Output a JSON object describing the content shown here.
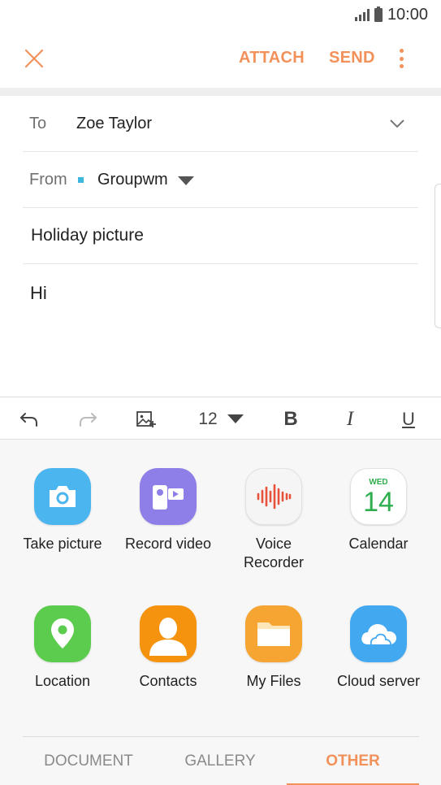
{
  "status_bar": {
    "time": "10:00",
    "signal_icon": "signal-icon",
    "battery_icon": "battery-icon"
  },
  "action_bar": {
    "close_icon": "close-icon",
    "attach_label": "ATTACH",
    "send_label": "SEND",
    "more_icon": "more-vertical-icon",
    "accent_color": "#f2915a"
  },
  "compose": {
    "to_label": "To",
    "to_value": "Zoe Taylor",
    "from_label": "From",
    "from_value": "Groupwm",
    "from_account_color": "#3eb7dc",
    "subject": "Holiday picture",
    "body": "Hi"
  },
  "toolbar": {
    "undo_icon": "undo-icon",
    "redo_icon": "redo-icon",
    "insert_image_icon": "insert-image-icon",
    "font_size": "12",
    "bold_label": "B",
    "italic_label": "I",
    "underline_label": "U"
  },
  "attach_panel": {
    "apps": [
      {
        "label": "Take picture",
        "icon": "camera-icon",
        "color": "#4bb5f0"
      },
      {
        "label": "Record video",
        "icon": "video-recorder-icon",
        "color": "#8d7ee8"
      },
      {
        "label": "Voice Recorder",
        "icon": "voice-recorder-icon",
        "color": "#f5f5f5"
      },
      {
        "label": "Calendar",
        "icon": "calendar-icon",
        "color": "#ffffff",
        "day": "WED",
        "date": "14"
      },
      {
        "label": "Location",
        "icon": "location-icon",
        "color": "#5ccc4e"
      },
      {
        "label": "Contacts",
        "icon": "contacts-icon",
        "color": "#f5930e"
      },
      {
        "label": "My Files",
        "icon": "folder-icon",
        "color": "#f7a532"
      },
      {
        "label": "Cloud server",
        "icon": "cloud-icon",
        "color": "#42a8ef"
      }
    ]
  },
  "tabs": [
    {
      "label": "DOCUMENT",
      "active": false
    },
    {
      "label": "GALLERY",
      "active": false
    },
    {
      "label": "OTHER",
      "active": true
    }
  ]
}
